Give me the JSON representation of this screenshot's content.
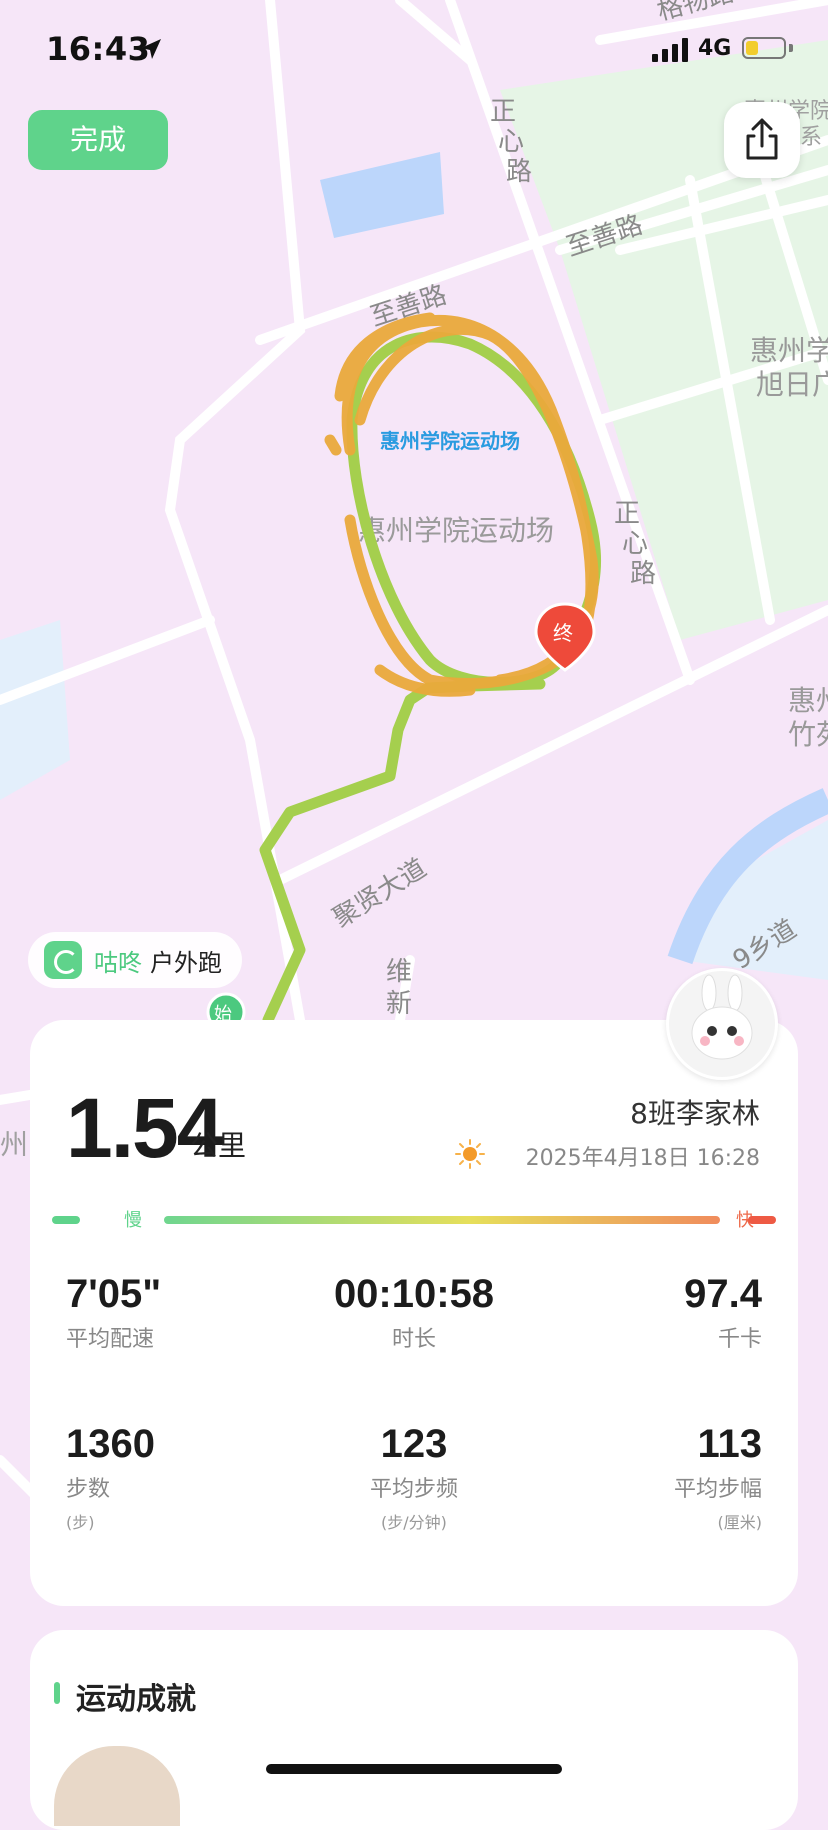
{
  "status": {
    "time": "16:43",
    "network": "4G"
  },
  "header": {
    "done_label": "完成"
  },
  "map": {
    "labels": [
      "格物路",
      "惠州学院\n系",
      "正心路",
      "至善路",
      "至善路",
      "惠州学院运动场",
      "惠州学院运动场",
      "正心路",
      "惠州学\n旭日广",
      "惠州\n竹苑",
      "聚贤大道",
      "维新",
      "9乡道",
      "州"
    ],
    "end_marker": "终",
    "start_marker": "始"
  },
  "brand": {
    "name": "咕咚",
    "activity": "户外跑"
  },
  "summary": {
    "distance": "1.54",
    "distance_unit": "公里",
    "runner": "8班李家林",
    "datetime": "2025年4月18日 16:28",
    "slow_label": "慢",
    "fast_label": "快"
  },
  "stats": [
    {
      "value": "7'05\"",
      "label": "平均配速",
      "unit": ""
    },
    {
      "value": "00:10:58",
      "label": "时长",
      "unit": ""
    },
    {
      "value": "97.4",
      "label": "千卡",
      "unit": ""
    },
    {
      "value": "1360",
      "label": "步数",
      "unit": "(步)"
    },
    {
      "value": "123",
      "label": "平均步频",
      "unit": "(步/分钟)"
    },
    {
      "value": "113",
      "label": "平均步幅",
      "unit": "(厘米)"
    }
  ],
  "achievements": {
    "title": "运动成就"
  },
  "colors": {
    "accent": "#5fd38b",
    "route_orange": "#e9a93b",
    "route_green": "#a5cf4e",
    "map_pink": "#f6e6f8",
    "map_green": "#e6f5e6"
  }
}
